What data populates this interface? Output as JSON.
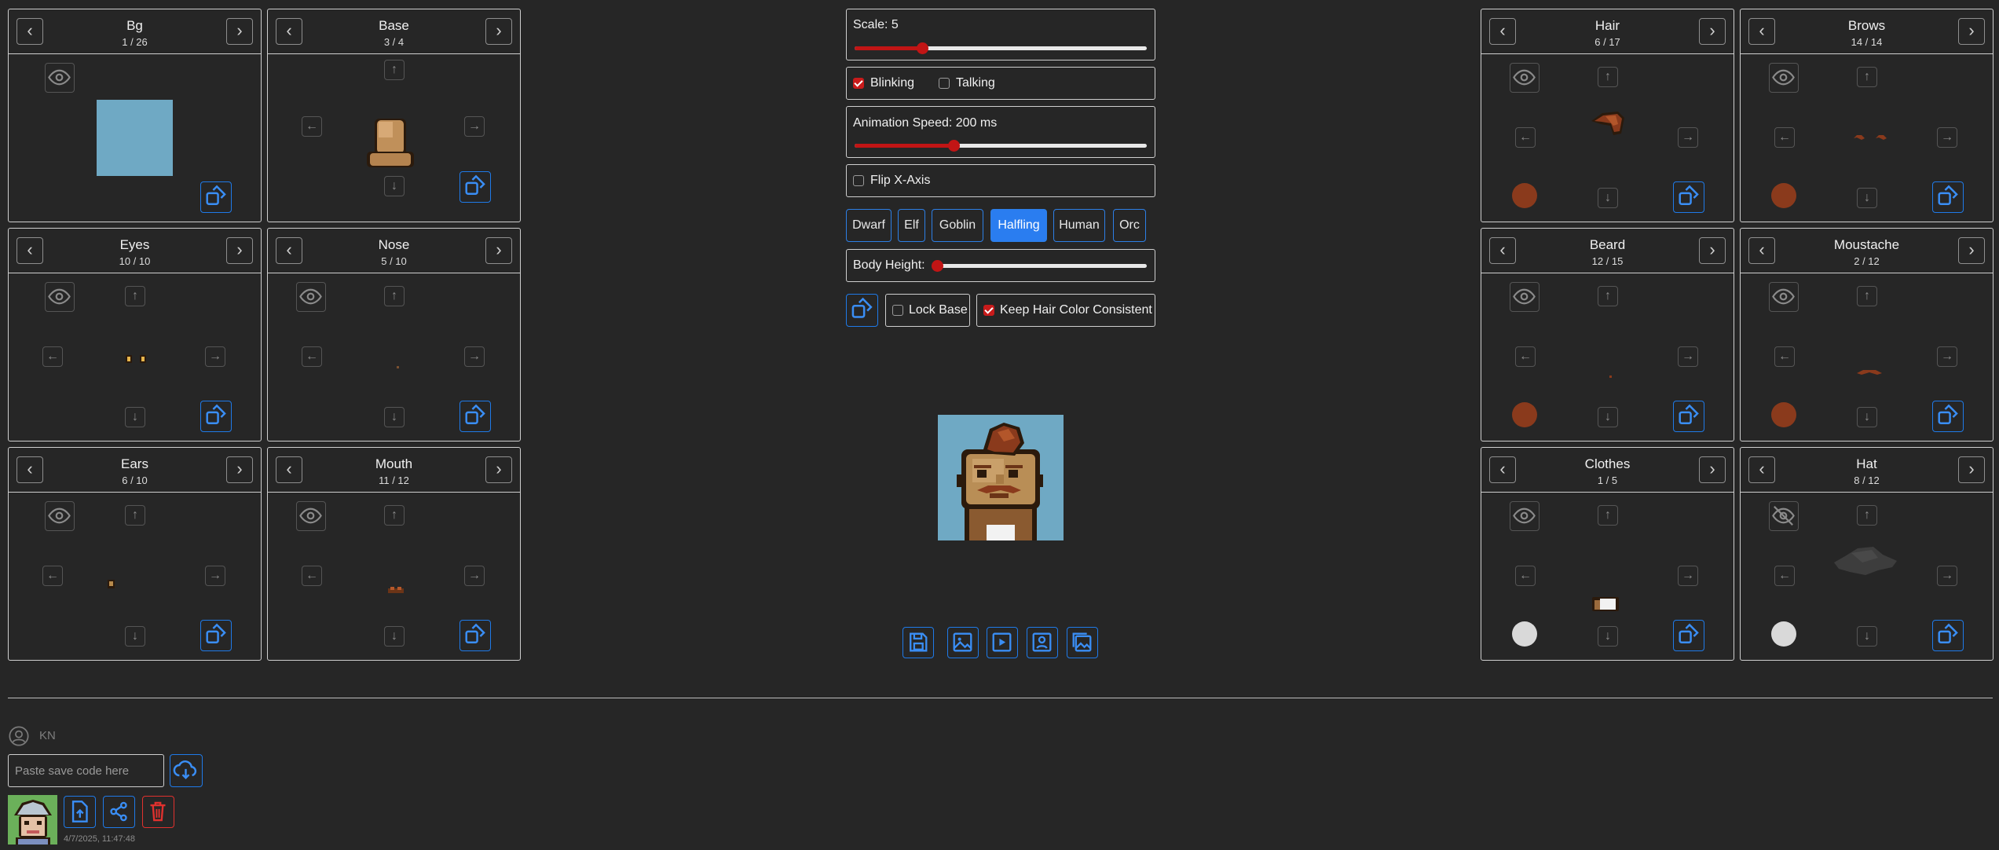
{
  "panels": {
    "bg": {
      "title": "Bg",
      "count": "1 / 26"
    },
    "base": {
      "title": "Base",
      "count": "3 / 4"
    },
    "eyes": {
      "title": "Eyes",
      "count": "10 / 10"
    },
    "nose": {
      "title": "Nose",
      "count": "5 / 10"
    },
    "ears": {
      "title": "Ears",
      "count": "6 / 10"
    },
    "mouth": {
      "title": "Mouth",
      "count": "11 / 12"
    },
    "hair": {
      "title": "Hair",
      "count": "6 / 17",
      "swatch_color": "#8a3a1c"
    },
    "brows": {
      "title": "Brows",
      "count": "14 / 14",
      "swatch_color": "#8a3a1c"
    },
    "beard": {
      "title": "Beard",
      "count": "12 / 15",
      "swatch_color": "#8a3a1c"
    },
    "moustache": {
      "title": "Moustache",
      "count": "2 / 12",
      "swatch_color": "#8a3a1c"
    },
    "clothes": {
      "title": "Clothes",
      "count": "1 / 5",
      "swatch_color": "#d9d9d9"
    },
    "hat": {
      "title": "Hat",
      "count": "8 / 12",
      "swatch_color": "#d9d9d9"
    }
  },
  "controls": {
    "scale_label": "Scale: 5",
    "scale_fraction": 0.23,
    "blinking_label": "Blinking",
    "blinking_checked": true,
    "talking_label": "Talking",
    "talking_checked": false,
    "speed_label": "Animation Speed: 200 ms",
    "speed_fraction": 0.34,
    "flip_label": "Flip X-Axis",
    "flip_checked": false,
    "races": [
      "Dwarf",
      "Elf",
      "Goblin",
      "Halfling",
      "Human",
      "Orc"
    ],
    "active_race": "Halfling",
    "body_height_label": "Body Height:",
    "body_height_fraction": 0.0,
    "lock_base_label": "Lock Base",
    "lock_base_checked": false,
    "keep_hair_label": "Keep Hair Color Consistent",
    "keep_hair_checked": true
  },
  "export_buttons": [
    "save-icon",
    "image-icon",
    "video-icon",
    "portrait-icon",
    "gallery-icon"
  ],
  "footer": {
    "user_initials": "KN",
    "save_code_placeholder": "Paste save code here",
    "saved_timestamp": "4/7/2025, 11:47:48"
  },
  "colors": {
    "accent_blue": "#2a7df0",
    "accent_red": "#c11515",
    "delete_red": "#e0312e",
    "background": "#262626",
    "preview_bg": "#6fa9c4"
  }
}
